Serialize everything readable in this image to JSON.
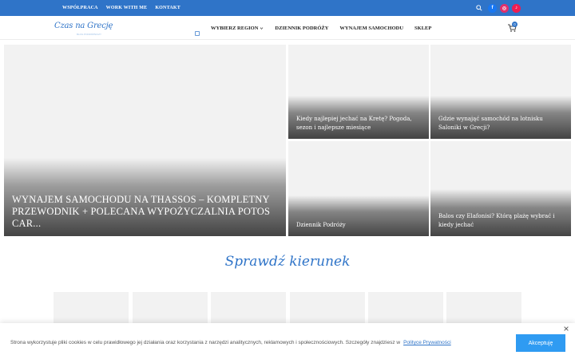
{
  "topbar": {
    "links": [
      "WSPÓŁPRACA",
      "WORK WITH ME",
      "KONTAKT"
    ],
    "social": [
      {
        "icon": "facebook-icon",
        "glyph": "f",
        "color": "#1877f2"
      },
      {
        "icon": "instagram-icon",
        "glyph": "◎",
        "color": "#e1306c"
      },
      {
        "icon": "tiktok-icon",
        "glyph": "♪",
        "color": "#ee1d52"
      }
    ]
  },
  "header": {
    "logo": "Czas na Grecję",
    "logo_sub": "BLOG PODRÓŻNICZY",
    "nav": [
      "WYBIERZ REGION",
      "DZIENNIK PODRÓŻY",
      "WYNAJEM SAMOCHODU",
      "SKLEP"
    ],
    "cart_count": "0"
  },
  "featured": {
    "title": "WYNAJEM SAMOCHODU NA THASSOS – KOMPLETNY PRZEWODNIK + POLECANA WYPOŻYCZALNIA POTOS CAR..."
  },
  "posts": [
    {
      "title": "Kiedy najlepiej jechać na Kretę? Pogoda, sezon i najlepsze miesiące"
    },
    {
      "title": "Gdzie wynająć samochód na lotnisku Saloniki w Grecji?"
    },
    {
      "title": "Dziennik Podróży"
    },
    {
      "title": "Balos czy Elafonisi? Którą plażę wybrać i kiedy jechać"
    }
  ],
  "section": {
    "title": "Sprawdź kierunek"
  },
  "cookie": {
    "text": "Strona wykorzystuje pliki cookies w celu prawidłowego jej działania oraz korzystania z narzędzi analitycznych, reklamowych i społecznościowych. Szczegóły znajdziesz w",
    "link": "Polityce Prywatności",
    "accept": "Akceptuję"
  },
  "colors": {
    "accent": "#2f74c8",
    "button": "#2f9bf2"
  }
}
